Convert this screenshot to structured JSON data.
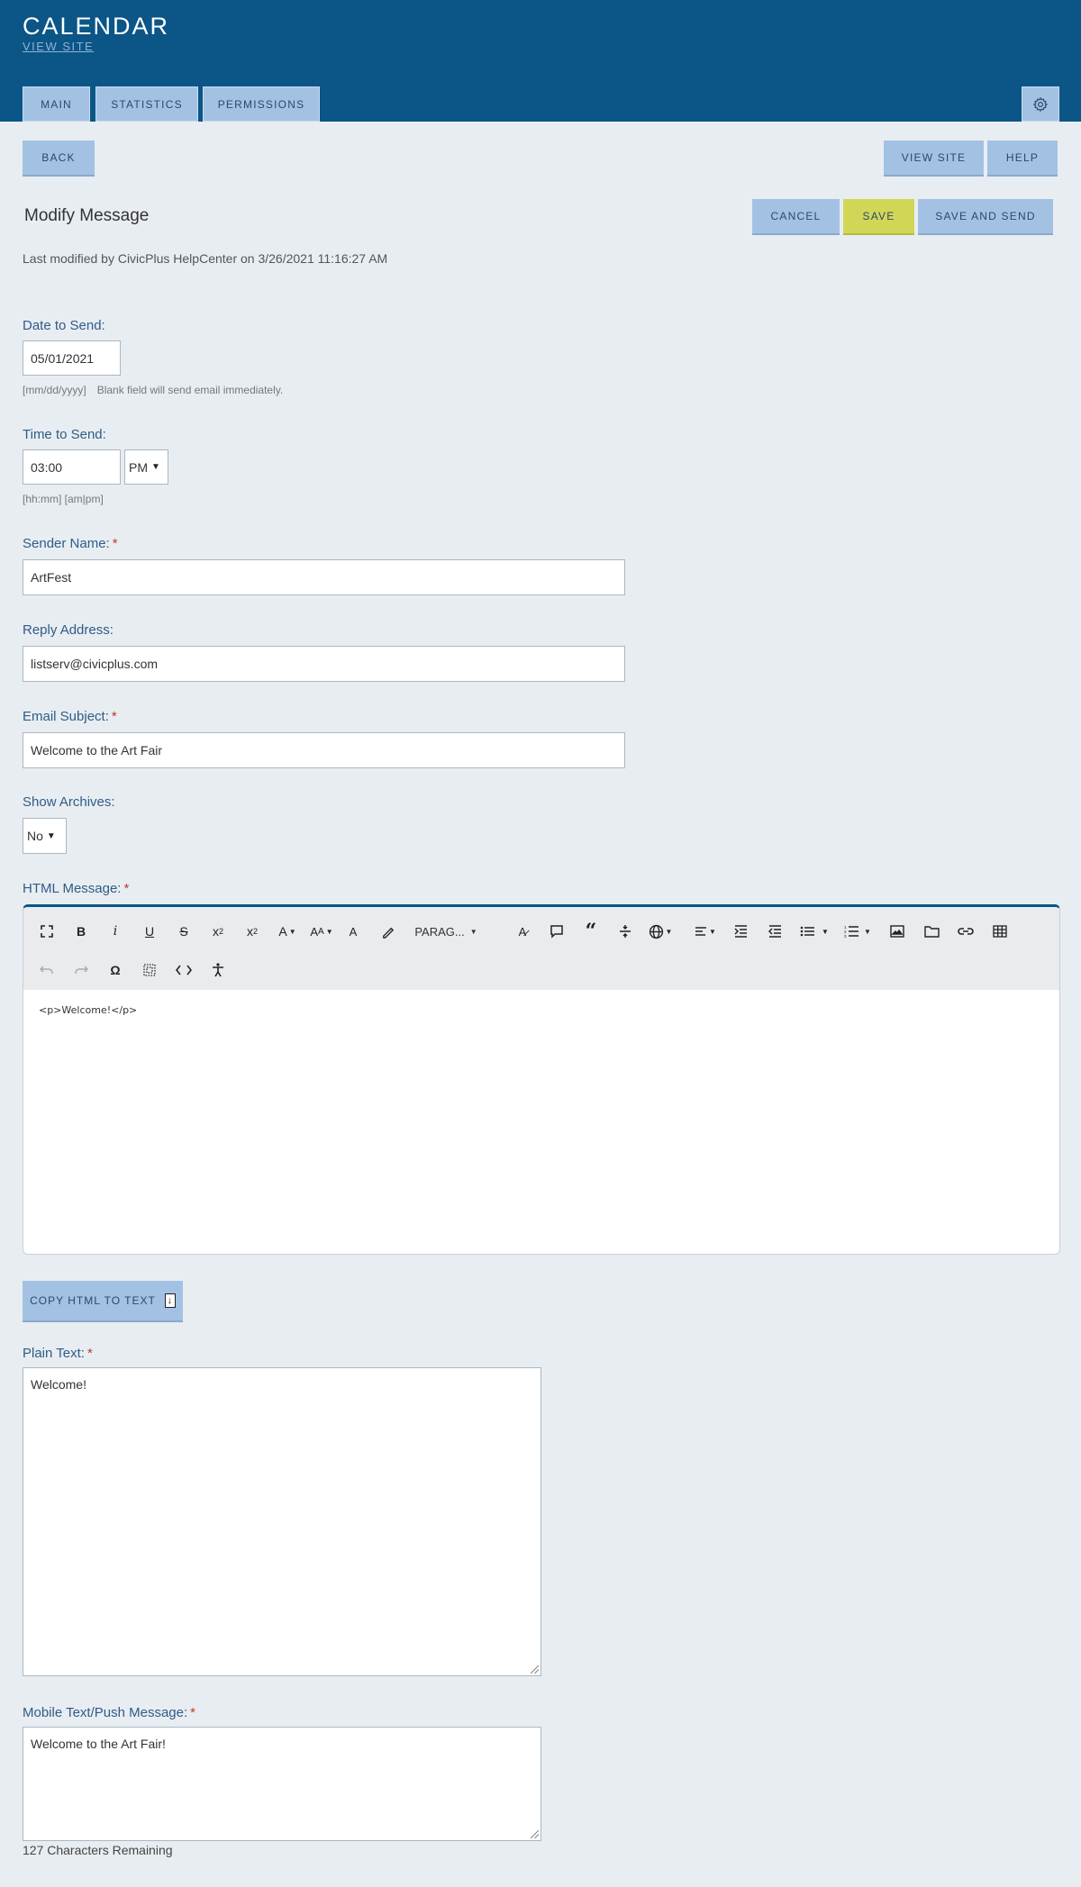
{
  "header": {
    "title": "CALENDAR",
    "view_site": "VIEW SITE",
    "tabs": [
      "MAIN",
      "STATISTICS",
      "PERMISSIONS"
    ]
  },
  "actions": {
    "back": "BACK",
    "view_site": "VIEW SITE",
    "help": "HELP",
    "cancel": "CANCEL",
    "save": "SAVE",
    "save_and_send": "SAVE AND SEND"
  },
  "page": {
    "title": "Modify Message",
    "last_modified": "Last modified by CivicPlus HelpCenter on 3/26/2021 11:16:27 AM"
  },
  "form": {
    "date_label": "Date to Send:",
    "date_value": "05/01/2021",
    "date_hint_format": "[mm/dd/yyyy]",
    "date_hint_note": "Blank field will send email immediately.",
    "time_label": "Time to Send:",
    "time_value": "03:00",
    "ampm_value": "PM",
    "time_hint": "[hh:mm] [am|pm]",
    "sender_label": "Sender Name:",
    "sender_value": "ArtFest",
    "reply_label": "Reply Address:",
    "reply_value": "listserv@civicplus.com",
    "subject_label": "Email Subject:",
    "subject_value": "Welcome to the Art Fair",
    "archives_label": "Show Archives:",
    "archives_value": "No",
    "html_label": "HTML Message:",
    "html_content": "<p>Welcome!</p>",
    "copy_button": "COPY HTML TO TEXT",
    "plain_label": "Plain Text:",
    "plain_value": "Welcome!",
    "mobile_label": "Mobile Text/Push Message:",
    "mobile_value": "Welcome to the Art Fair!",
    "remaining": "127 Characters Remaining",
    "required_mark": "*"
  },
  "editor": {
    "paragraph_label": "PARAG...",
    "toolbar_icons": [
      "fullscreen-icon",
      "bold-icon",
      "italic-icon",
      "underline-icon",
      "strikethrough-icon",
      "subscript-icon",
      "superscript-icon",
      "font-color-icon",
      "font-size-icon",
      "fill-color-icon",
      "highlight-icon",
      "paragraph-format-dropdown",
      "clear-formatting-icon",
      "comment-icon",
      "quote-icon",
      "horizontal-line-icon",
      "language-icon",
      "align-icon",
      "indent-icon",
      "outdent-icon",
      "bullet-list-icon",
      "numbered-list-icon",
      "image-icon",
      "folder-icon",
      "link-icon",
      "table-icon",
      "undo-icon",
      "redo-icon",
      "special-character-icon",
      "select-all-icon",
      "code-view-icon",
      "accessibility-icon"
    ]
  },
  "colors": {
    "header_bg": "#0b5587",
    "button_bg": "#a3c2e3",
    "save_bg": "#d2d657",
    "label_color": "#2f5c86",
    "page_bg": "#e8edf2"
  }
}
